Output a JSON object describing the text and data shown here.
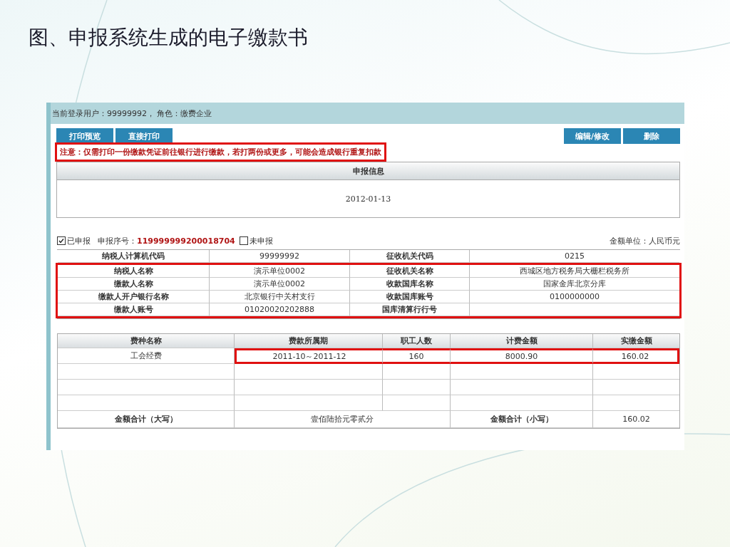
{
  "slide_title": "图、申报系统生成的电子缴款书",
  "header": {
    "user_info": "当前登录用户：99999992， 角色：缴费企业"
  },
  "left_buttons": [
    "打印预览",
    "直接打印"
  ],
  "right_buttons": [
    "编辑/修改",
    "删除"
  ],
  "notice": {
    "text": "注意：仅需打印一份缴款凭证前往银行进行缴款，若打两份或更多，可能会造成银行重复扣款",
    "highlighted": true
  },
  "declaration_panel": {
    "title": "申报信息",
    "date": "2012-01-13"
  },
  "status": {
    "declared": {
      "label": "已申报",
      "checked": true
    },
    "serial_label": "申报序号：",
    "serial": "119999999200018704",
    "undeclared": {
      "label": "未申报",
      "checked": false
    },
    "unit": "金额单位：人民币元"
  },
  "info_rows": [
    {
      "label_1": "纳税人计算机代码",
      "value_1": "99999992",
      "label_2": "征收机关代码",
      "value_2": "0215",
      "highlighted": false
    },
    {
      "label_1": "纳税人名称",
      "value_1": "演示单位0002",
      "label_2": "征收机关名称",
      "value_2": "西城区地方税务局大栅栏税务所",
      "highlighted": true
    },
    {
      "label_1": "缴款人名称",
      "value_1": "演示单位0002",
      "label_2": "收款国库名称",
      "value_2": "国家金库北京分库",
      "highlighted": true
    },
    {
      "label_1": "缴款人开户银行名称",
      "value_1": "北京银行中关村支行",
      "label_2": "收款国库账号",
      "value_2": "0100000000",
      "highlighted": true
    },
    {
      "label_1": "缴款人账号",
      "value_1": "01020020202888",
      "label_2": "国库清算行行号",
      "value_2": "",
      "highlighted": true
    }
  ],
  "fee_table": {
    "columns": [
      "费种名称",
      "费款所属期",
      "职工人数",
      "计费金额",
      "实缴金额"
    ],
    "rows": [
      [
        {
          "text": "工会经费",
          "highlighted": false
        },
        {
          "text": "2011-10～2011-12",
          "highlighted": true
        },
        {
          "text": "160",
          "highlighted": true
        },
        {
          "text": "8000.90",
          "highlighted": true
        },
        {
          "text": "160.02",
          "highlighted": true
        }
      ],
      [
        {
          "text": "",
          "highlighted": false
        },
        {
          "text": "",
          "highlighted": false
        },
        {
          "text": "",
          "highlighted": false
        },
        {
          "text": "",
          "highlighted": false
        },
        {
          "text": "",
          "highlighted": false
        }
      ],
      [
        {
          "text": "",
          "highlighted": false
        },
        {
          "text": "",
          "highlighted": false
        },
        {
          "text": "",
          "highlighted": false
        },
        {
          "text": "",
          "highlighted": false
        },
        {
          "text": "",
          "highlighted": false
        }
      ],
      [
        {
          "text": "",
          "highlighted": false
        },
        {
          "text": "",
          "highlighted": false
        },
        {
          "text": "",
          "highlighted": false
        },
        {
          "text": "",
          "highlighted": false
        },
        {
          "text": "",
          "highlighted": false
        }
      ]
    ],
    "total": {
      "upper_label": "金额合计（大写）",
      "upper_value": "壹佰陆拾元零贰分",
      "lower_label": "金额合计（小写）",
      "lower_value": "160.02"
    }
  }
}
